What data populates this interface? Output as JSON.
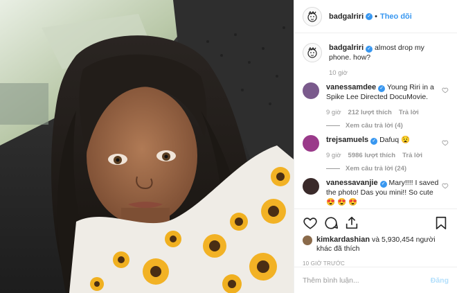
{
  "header": {
    "username": "badgalriri",
    "dot": "•",
    "follow_label": "Theo dõi"
  },
  "caption": {
    "username": "badgalriri",
    "text": "almost drop my phone. how?",
    "time": "10 giờ"
  },
  "comments": [
    {
      "username": "vanessamdee",
      "text": "Young Riri in a Spike Lee Directed DocuMovie.",
      "time": "9 giờ",
      "likes": "212 lượt thích",
      "reply_label": "Trả lời",
      "view_replies": "Xem câu trả lời (4)",
      "avatar_color": "#7a5a8c"
    },
    {
      "username": "trejsamuels",
      "text": "Dafuq 😧",
      "time": "9 giờ",
      "likes": "5986 lượt thích",
      "reply_label": "Trả lời",
      "view_replies": "Xem câu trả lời (24)",
      "avatar_color": "#9a3a8a"
    },
    {
      "username": "vanessavanjie",
      "text": "Mary!!!! I saved the photo! Das you mini!! So cute 😍 😍 😍",
      "avatar_color": "#3a2a2a"
    }
  ],
  "likes": {
    "liked_by": "kimkardashian",
    "rest": "và 5,930,454 người khác đã thích"
  },
  "timestamp": "10 giờ trước",
  "composer": {
    "placeholder": "Thêm bình luận...",
    "post_label": "Đăng"
  },
  "colors": {
    "link_blue": "#3897f0",
    "verified_blue": "#3897f0",
    "muted": "#999999",
    "post_disabled": "#b2dffc"
  }
}
